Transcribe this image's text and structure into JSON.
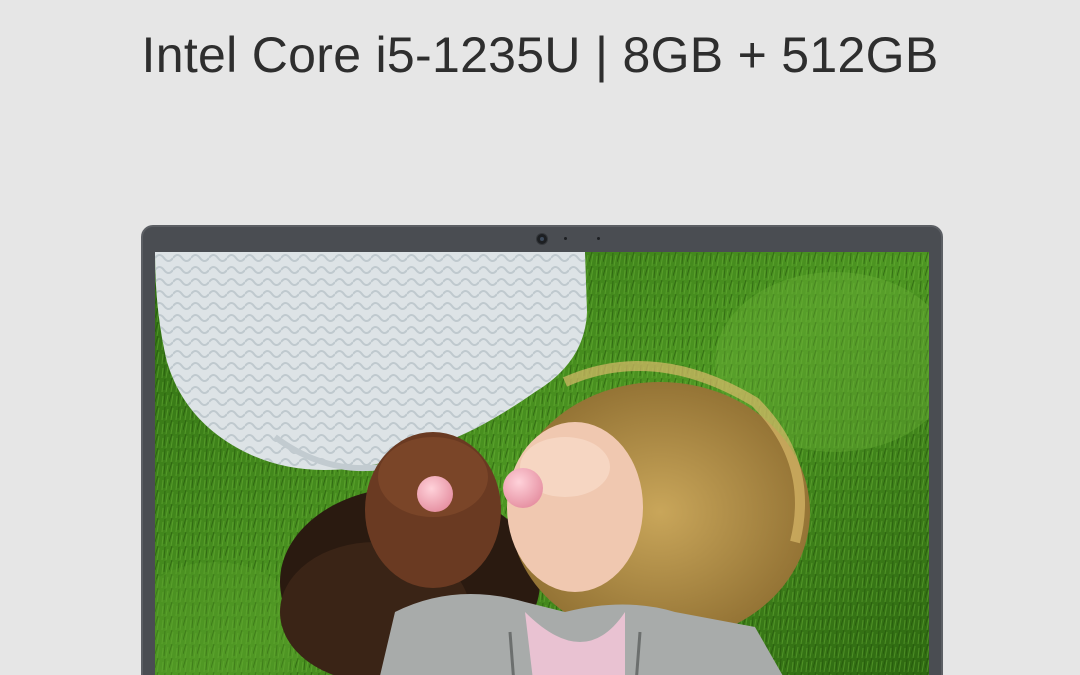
{
  "headline": "Intel Core i5-1235U | 8GB + 512GB",
  "colors": {
    "page_background": "#e6e6e6",
    "laptop_frame": "#4a4d52",
    "grass": "#3f8a1c",
    "headline_text": "#2e2e2e"
  },
  "image": {
    "subject": "two people lying on grass blowing bubble gum"
  }
}
